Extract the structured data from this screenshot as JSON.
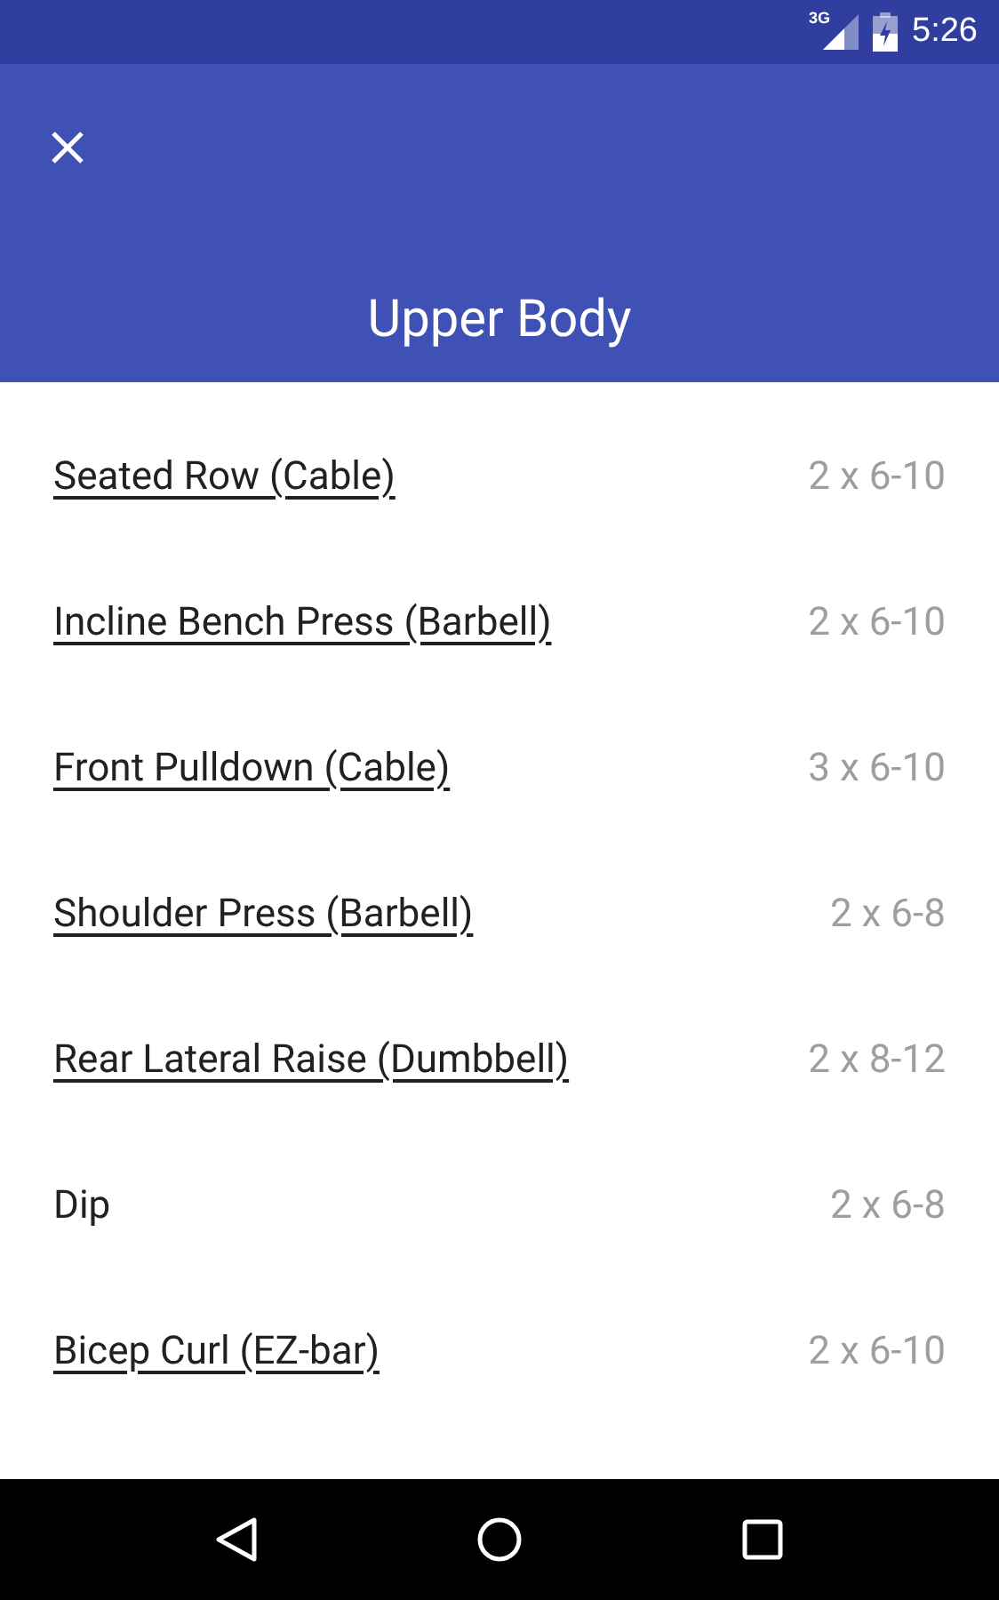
{
  "status_bar": {
    "network": "3G",
    "time": "5:26"
  },
  "toolbar": {
    "title": "Upper Body"
  },
  "exercises": [
    {
      "name": "Seated Row (Cable)",
      "sets": "2 x 6-10",
      "linked": true
    },
    {
      "name": "Incline Bench Press (Barbell)",
      "sets": "2 x 6-10",
      "linked": true
    },
    {
      "name": "Front Pulldown (Cable)",
      "sets": "3 x 6-10",
      "linked": true
    },
    {
      "name": "Shoulder Press (Barbell)",
      "sets": "2 x 6-8",
      "linked": true
    },
    {
      "name": "Rear Lateral Raise (Dumbbell)",
      "sets": "2 x 8-12",
      "linked": true
    },
    {
      "name": "Dip",
      "sets": "2 x 6-8",
      "linked": false
    },
    {
      "name": "Bicep Curl (EZ-bar)",
      "sets": "2 x 6-10",
      "linked": true
    }
  ]
}
